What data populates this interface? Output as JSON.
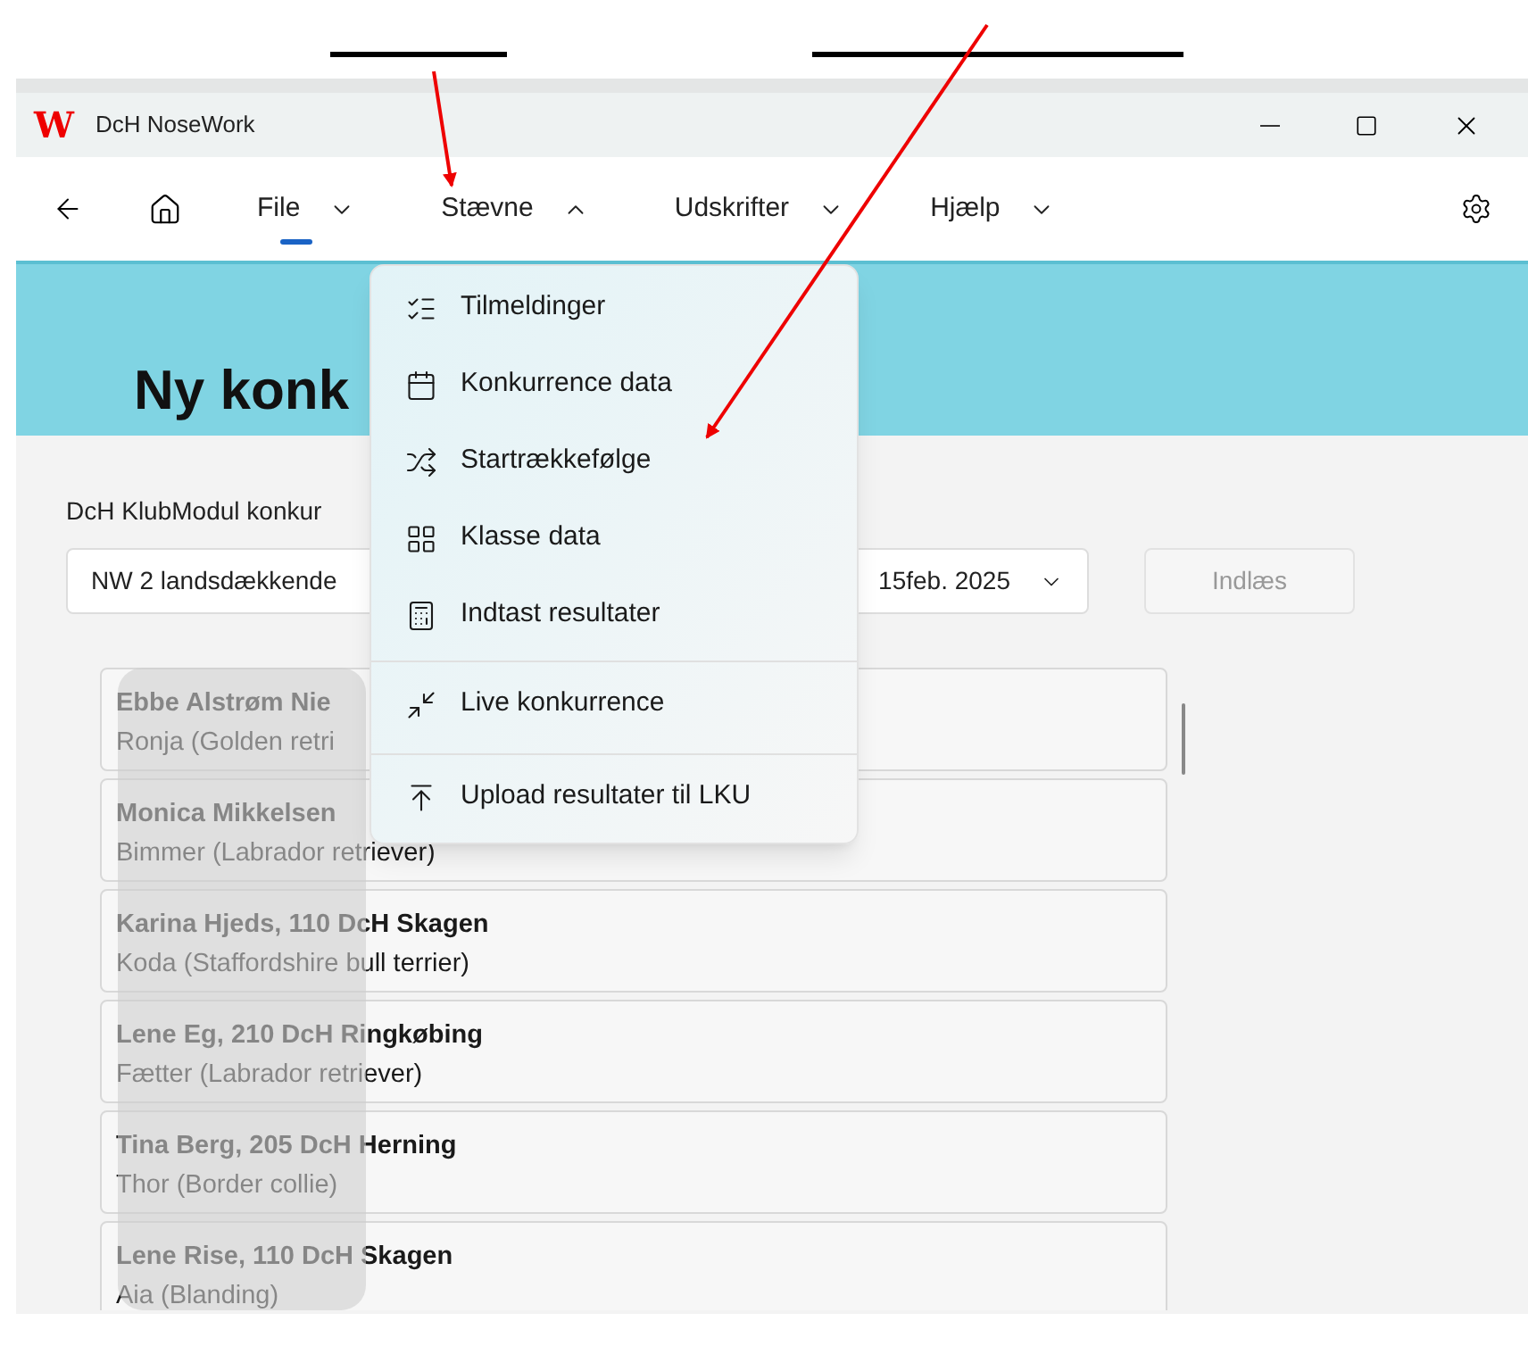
{
  "window": {
    "logo": "W",
    "title": "DcH NoseWork"
  },
  "nav": [
    {
      "label": "File",
      "selected": true,
      "expanded": false
    },
    {
      "label": "Stævne",
      "selected": false,
      "expanded": true
    },
    {
      "label": "Udskrifter",
      "selected": false,
      "expanded": false
    },
    {
      "label": "Hjælp",
      "selected": false,
      "expanded": false
    }
  ],
  "heading": "Ny konk",
  "source_label": "DcH KlubModul konkur",
  "competition_select": {
    "value": "NW 2 landsdækkende",
    "date": "15feb. 2025"
  },
  "load_button": {
    "label": "Indlæs",
    "disabled": true
  },
  "entries": [
    {
      "handler": "Ebbe Alstrøm Nie",
      "dog": "Ronja (Golden retri"
    },
    {
      "handler": "Monica Mikkelsen",
      "dog": "Bimmer (Labrador retriever)"
    },
    {
      "handler": "Karina Hjeds, 110 DcH Skagen",
      "dog": "Koda (Staffordshire bull terrier)"
    },
    {
      "handler": "Lene Eg, 210 DcH Ringkøbing",
      "dog": "Fætter (Labrador retriever)"
    },
    {
      "handler": "Tina Berg, 205 DcH Herning",
      "dog": "Thor (Border collie)"
    },
    {
      "handler": "Lene Rise, 110 DcH Skagen",
      "dog": "Aia (Blanding)"
    }
  ],
  "dropdown_menu": [
    {
      "label": "Tilmeldinger",
      "divider_before": false
    },
    {
      "label": "Konkurrence data",
      "divider_before": false
    },
    {
      "label": "Startrækkefølge",
      "divider_before": false
    },
    {
      "label": "Klasse data",
      "divider_before": false
    },
    {
      "label": "Indtast resultater",
      "divider_before": false
    },
    {
      "label": "Live konkurrence",
      "divider_before": true
    },
    {
      "label": "Upload resultater til LKU",
      "divider_before": true
    }
  ]
}
